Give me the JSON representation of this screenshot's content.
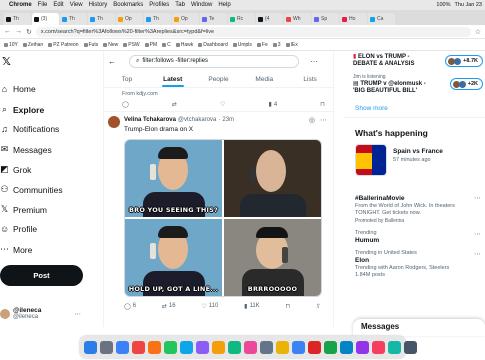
{
  "menubar": {
    "apple": "",
    "items": [
      "Chrome",
      "File",
      "Edit",
      "View",
      "History",
      "Bookmarks",
      "Profiles",
      "Tab",
      "Window",
      "Help"
    ],
    "battery": "100%",
    "date": "Thu Jan 23"
  },
  "tabs": [
    {
      "label": "Th",
      "color": "#0f1419"
    },
    {
      "label": "(3)",
      "color": "#0f1419"
    },
    {
      "label": "Th",
      "color": "#1d9bf0"
    },
    {
      "label": "Th",
      "color": "#1d9bf0"
    },
    {
      "label": "Op",
      "color": "#f59e0b"
    },
    {
      "label": "Th",
      "color": "#1d9bf0"
    },
    {
      "label": "Op",
      "color": "#f59e0b"
    },
    {
      "label": "Te",
      "color": "#6366f1"
    },
    {
      "label": "Rc",
      "color": "#10b981"
    },
    {
      "label": "(4",
      "color": "#0f1419"
    },
    {
      "label": "Wh",
      "color": "#ef4444"
    },
    {
      "label": "Sp",
      "color": "#6366f1"
    },
    {
      "label": "Ho",
      "color": "#e11d48"
    },
    {
      "label": "Ca",
      "color": "#0ea5e9"
    }
  ],
  "address": {
    "url": "x.com/search?q=filter%3Afollows%20-filter%3Areplies&src=typd&f=live"
  },
  "bookmarks": [
    "10Y",
    "Zeihan",
    "PZ Patreon",
    "Futs",
    "New",
    "PSW",
    "PM",
    "C",
    "Hawk",
    "Dashboard",
    "Umpls",
    "Fe",
    "3",
    "IEx"
  ],
  "nav": {
    "home": "Home",
    "explore": "Explore",
    "notifications": "Notifications",
    "messages": "Messages",
    "grok": "Grok",
    "communities": "Communities",
    "premium": "Premium",
    "profile": "Profile",
    "more": "More",
    "post": "Post",
    "account_name": "@ileneca",
    "account_handle": "@ileneca"
  },
  "feed": {
    "search": "filter:follows -filter:replies",
    "tabs": [
      "Top",
      "Latest",
      "People",
      "Media",
      "Lists"
    ],
    "prev_source": "From kdjy.com",
    "prev_actions": {
      "like": "4"
    },
    "tweet": {
      "name": "Velina Tchakarova",
      "handle": "@vtchakarova",
      "time": "23m",
      "text": "Trump-Elon drama on X",
      "captions": {
        "top": "BRO YOU SEEING THIS?",
        "bottom": "HOLD UP, GOT A LINE...",
        "br": "BRRROOOOO"
      },
      "actions": {
        "reply": "6",
        "retweet": "16",
        "like": "110",
        "views": "11K"
      }
    }
  },
  "sidebar": {
    "live1": {
      "title": "ELON vs TRUMP - DEBATE & ANALYSIS",
      "count": "+8.7K"
    },
    "live2": {
      "by": "Jim is listening",
      "title": "TRUMP v @elonmusk - 'BIG BEAUTIFUL BILL'",
      "count": "+2K"
    },
    "show_more": "Show more",
    "happening_title": "What's happening",
    "big": {
      "title": "Spain vs France",
      "sub": "57 minutes ago"
    },
    "trends": [
      {
        "name": "#BallerinaMovie",
        "desc": "From the World of John Wick. In theaters TONIGHT. Get tickets now.",
        "promo": "Promoted by Ballerina"
      },
      {
        "cat": "Trending",
        "name": "Humum"
      },
      {
        "cat": "Trending in United States",
        "name": "Elon",
        "desc": "Trending with Aaron Rodgers, Steelers",
        "count": "1.84M posts"
      }
    ],
    "messages": "Messages"
  },
  "colors": {
    "accent": "#1d9bf0",
    "text": "#0f1419",
    "muted": "#536471"
  },
  "dock_colors": [
    "#2b7de9",
    "#6b7280",
    "#3b82f6",
    "#ef4444",
    "#f97316",
    "#22c55e",
    "#0ea5e9",
    "#8b5cf6",
    "#f59e0b",
    "#10b981",
    "#ec4899",
    "#64748b",
    "#eab308",
    "#3b82f6",
    "#dc2626",
    "#16a34a",
    "#0284c7",
    "#9333ea",
    "#f43f5e",
    "#14b8a6",
    "#475569"
  ]
}
